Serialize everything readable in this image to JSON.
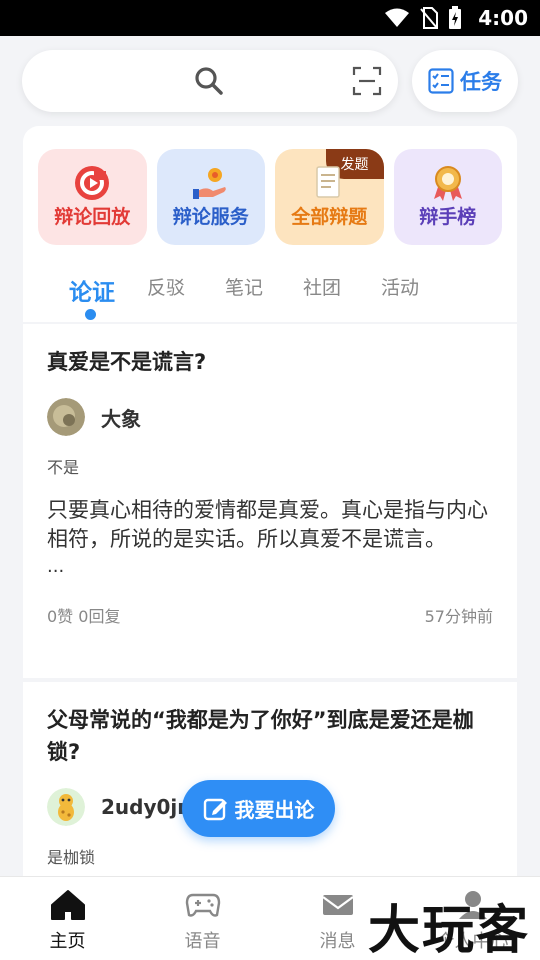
{
  "status_bar": {
    "time": "4:00"
  },
  "search": {
    "placeholder": ""
  },
  "task_button": {
    "label": "任务"
  },
  "tiles": [
    {
      "label": "辩论回放",
      "icon": "replay-icon"
    },
    {
      "label": "辩论服务",
      "icon": "service-icon"
    },
    {
      "label": "全部辩题",
      "icon": "document-icon",
      "badge": "发题"
    },
    {
      "label": "辩手榜",
      "icon": "medal-icon"
    }
  ],
  "tabs": [
    "论证",
    "反驳",
    "笔记",
    "社团",
    "活动"
  ],
  "posts": [
    {
      "title": "真爱是不是谎言?",
      "author": "大象",
      "stance": "不是",
      "body": "只要真心相待的爱情都是真爱。真心是指与内心相符，所说的是实话。所以真爱不是谎言。",
      "more": "...",
      "stats": "0赞 0回复",
      "time": "57分钟前"
    },
    {
      "title": "父母常说的“我都是为了你好”到底是爱还是枷锁?",
      "author": "2udy0jnt",
      "stance": "是枷锁"
    }
  ],
  "fab": {
    "label": "我要出论"
  },
  "bottom_nav": [
    {
      "label": "主页",
      "icon": "home-icon"
    },
    {
      "label": "语音",
      "icon": "gamepad-icon"
    },
    {
      "label": "消息",
      "icon": "mail-icon"
    },
    {
      "label": "个人中心",
      "icon": "person-icon"
    }
  ],
  "watermark": "大玩客",
  "colors": {
    "accent": "#2b8df0",
    "fab": "#2f8ef5"
  }
}
